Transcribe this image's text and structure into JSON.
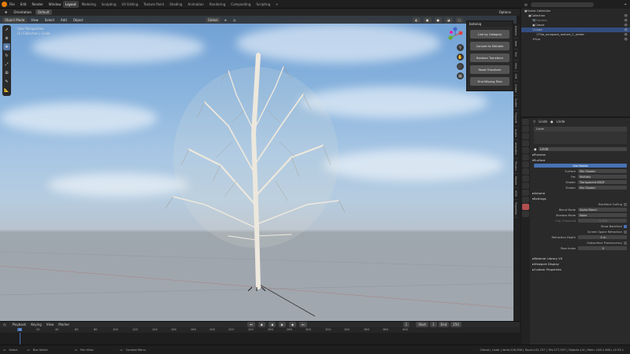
{
  "menu": [
    "File",
    "Edit",
    "Render",
    "Window",
    "Help"
  ],
  "workspaces": [
    "Layout",
    "Modeling",
    "Sculpting",
    "UV Editing",
    "Texture Paint",
    "Shading",
    "Animation",
    "Rendering",
    "Compositing",
    "Scripting"
  ],
  "active_workspace": "Layout",
  "scene": "Scene",
  "view_layer": "View Layer",
  "vp": {
    "mode": "Object Mode",
    "view": "View",
    "select": "Select",
    "add": "Add",
    "object": "Object",
    "orientation": "Orientation",
    "default": "Default",
    "transform": "Global",
    "options": "Options"
  },
  "vp_info": {
    "line1": "User Perspective",
    "line2": "(1) Collection | Linde"
  },
  "botaniq": {
    "title": "botaniq",
    "buttons": [
      "Link by Category",
      "Convert to Editable",
      "Random Transform",
      "Reset Transform",
      "Find Missing Files"
    ]
  },
  "outliner": {
    "rows": [
      "Scene Collection",
      "Collection",
      "Camera",
      "Climat",
      "Linde",
      "Tilia_europaea_mature_C_winter",
      "Sun"
    ]
  },
  "props": {
    "tab1": "Linde",
    "tab2": "Linde",
    "material": "Linde",
    "sections": {
      "preview": "Preview",
      "surface": "Surface",
      "volume": "Volume",
      "settings": "Settings",
      "line_art": "Material Library VX",
      "viewport_display": "Viewport Display",
      "custom_props": "Custom Properties"
    },
    "use_nodes": "Use Nodes",
    "surface_label": "Surface",
    "surface_val": "Mix Shader",
    "fac_label": "Fac",
    "fac_val": "Multiply",
    "shader1_label": "Shader",
    "shader1_val": "Transparent BSDF",
    "shader2_label": "Shader",
    "shader2_val": "Mix Shader",
    "backface": "Backface Culling",
    "blend_label": "Blend Mode",
    "blend_val": "Alpha Blend",
    "shadow_label": "Shadow Mode",
    "shadow_val": "None",
    "clip_label": "Clip Threshold",
    "clip_val": "0.500",
    "show_backface": "Show Backface",
    "ssr": "Screen Space Refraction",
    "refr_label": "Refraction Depth",
    "refr_val": "0 m",
    "sss": "Subsurface Translucency",
    "pass_label": "Pass Index",
    "pass_val": "0"
  },
  "timeline": {
    "playback": "Playback",
    "keying": "Keying",
    "view": "View",
    "marker": "Marker",
    "frame": "1",
    "start_label": "Start",
    "start": "1",
    "end_label": "End",
    "end": "250",
    "ticks": [
      "0",
      "20",
      "40",
      "60",
      "80",
      "100",
      "120",
      "140",
      "160",
      "180",
      "200",
      "220",
      "240",
      "260",
      "280",
      "300",
      "320",
      "340",
      "360",
      "380",
      "400"
    ]
  },
  "status": {
    "select": "Select",
    "box": "Box Select",
    "pan": "Pan View",
    "ctx": "Context Menu",
    "info": "Climat | Linde | Verts:226,956 | Faces:141,747 | Tris:277,937 | Objects:1/4 | Mem: 248.2 MiB | v2.93.1"
  },
  "colors": {
    "accent": "#5679aa",
    "active_tab": "#3d3d3d"
  }
}
